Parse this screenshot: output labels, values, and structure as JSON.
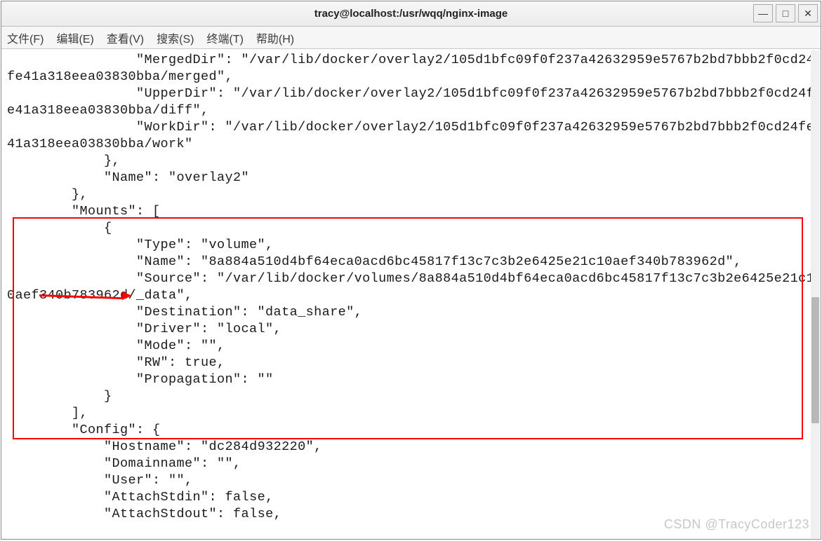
{
  "titlebar": {
    "title": "tracy@localhost:/usr/wqq/nginx-image"
  },
  "window_controls": {
    "minimize": "—",
    "maximize": "□",
    "close": "✕"
  },
  "menubar": {
    "file": "文件(F)",
    "edit": "编辑(E)",
    "view": "查看(V)",
    "search": "搜索(S)",
    "terminal": "终端(T)",
    "help": "帮助(H)"
  },
  "terminal_output": {
    "lines": [
      "                \"MergedDir\": \"/var/lib/docker/overlay2/105d1bfc09f0f237a42632959e5767b2bd7bbb2f0cd24fe41a318eea03830bba/merged\",",
      "                \"UpperDir\": \"/var/lib/docker/overlay2/105d1bfc09f0f237a42632959e5767b2bd7bbb2f0cd24fe41a318eea03830bba/diff\",",
      "                \"WorkDir\": \"/var/lib/docker/overlay2/105d1bfc09f0f237a42632959e5767b2bd7bbb2f0cd24fe41a318eea03830bba/work\"",
      "            },",
      "            \"Name\": \"overlay2\"",
      "        },",
      "        \"Mounts\": [",
      "            {",
      "                \"Type\": \"volume\",",
      "                \"Name\": \"8a884a510d4bf64eca0acd6bc45817f13c7c3b2e6425e21c10aef340b783962d\",",
      "                \"Source\": \"/var/lib/docker/volumes/8a884a510d4bf64eca0acd6bc45817f13c7c3b2e6425e21c10aef340b783962d/_data\",",
      "                \"Destination\": \"data_share\",",
      "                \"Driver\": \"local\",",
      "                \"Mode\": \"\",",
      "                \"RW\": true,",
      "                \"Propagation\": \"\"",
      "            }",
      "        ],",
      "        \"Config\": {",
      "            \"Hostname\": \"dc284d932220\",",
      "            \"Domainname\": \"\",",
      "            \"User\": \"\",",
      "            \"AttachStdin\": false,",
      "            \"AttachStdout\": false,"
    ]
  },
  "watermark": "CSDN @TracyCoder123"
}
